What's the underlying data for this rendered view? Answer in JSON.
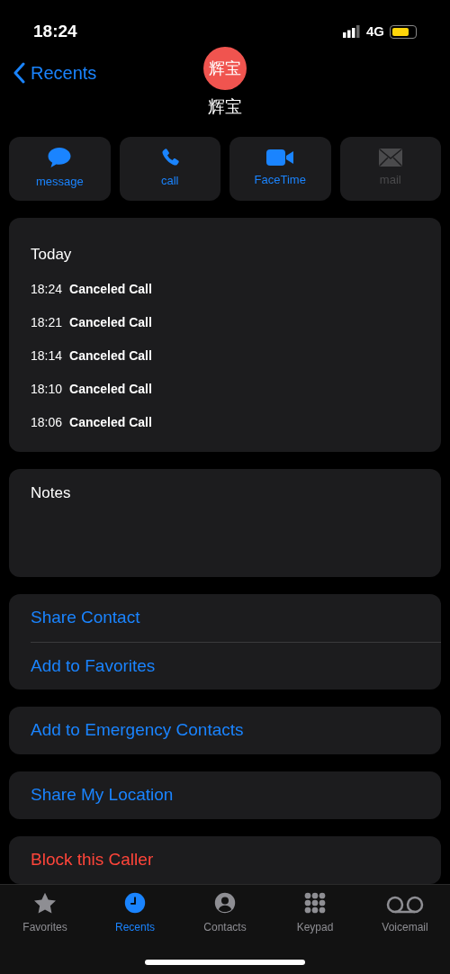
{
  "status_bar": {
    "time": "18:24",
    "network": "4G"
  },
  "nav": {
    "back_label": "Recents"
  },
  "contact": {
    "avatar_text": "辉宝",
    "name": "辉宝"
  },
  "actions": [
    {
      "kind": "message",
      "label": "message",
      "disabled": false
    },
    {
      "kind": "call",
      "label": "call",
      "disabled": false
    },
    {
      "kind": "video",
      "label": "FaceTime",
      "disabled": false
    },
    {
      "kind": "mail",
      "label": "mail",
      "disabled": true
    }
  ],
  "call_history": {
    "heading": "Today",
    "calls": [
      {
        "time": "18:24",
        "status": "Canceled Call"
      },
      {
        "time": "18:21",
        "status": "Canceled Call"
      },
      {
        "time": "18:14",
        "status": "Canceled Call"
      },
      {
        "time": "18:10",
        "status": "Canceled Call"
      },
      {
        "time": "18:06",
        "status": "Canceled Call"
      }
    ]
  },
  "notes": {
    "label": "Notes"
  },
  "option_groups": [
    [
      {
        "label": "Share Contact",
        "kind": "normal"
      },
      {
        "label": "Add to Favorites",
        "kind": "normal"
      }
    ],
    [
      {
        "label": "Add to Emergency Contacts",
        "kind": "normal"
      }
    ],
    [
      {
        "label": "Share My Location",
        "kind": "normal"
      }
    ],
    [
      {
        "label": "Block this Caller",
        "kind": "destructive"
      }
    ]
  ],
  "tab_bar": [
    {
      "kind": "favorites",
      "label": "Favorites",
      "selected": false
    },
    {
      "kind": "recents",
      "label": "Recents",
      "selected": true
    },
    {
      "kind": "contacts",
      "label": "Contacts",
      "selected": false
    },
    {
      "kind": "keypad",
      "label": "Keypad",
      "selected": false
    },
    {
      "kind": "voicemail",
      "label": "Voicemail",
      "selected": false
    }
  ]
}
